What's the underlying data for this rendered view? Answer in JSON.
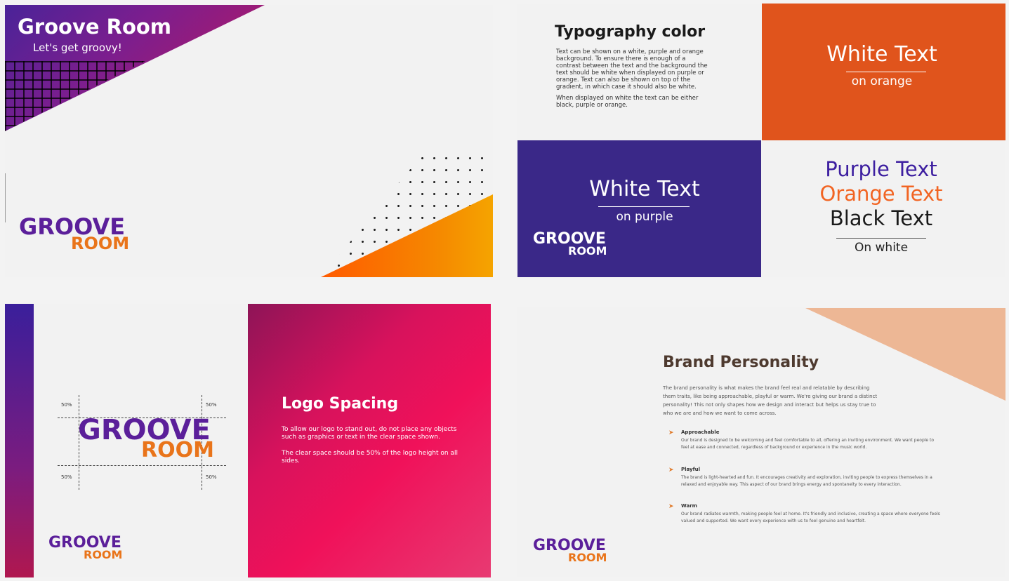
{
  "panel1": {
    "title": "Groove Room",
    "subtitle": "Let's get groovy!",
    "logo": {
      "line1": "GROOVE",
      "line2": "ROOM"
    }
  },
  "panel2": {
    "heading": "Typography color",
    "body": [
      "Text can be shown on a white, purple and orange background. To ensure there is enough of a contrast between the text and the background the text should be white when displayed on purple or orange. Text can also be shown on top of the gradient, in which case it should also be white.",
      "When displayed on white the text can be either black, purple or orange."
    ],
    "orange_card": {
      "main": "White Text",
      "sub": "on orange",
      "color": "#e0541c"
    },
    "purple_card": {
      "main": "White Text",
      "sub": "on purple",
      "color": "#3a2888"
    },
    "white_card": {
      "purple": "Purple Text",
      "orange": "Orange Text",
      "black": "Black Text",
      "sub": "On white"
    },
    "logo": {
      "line1": "GROOVE",
      "line2": "ROOM"
    },
    "colors": {
      "purple_text": "#3d1fa0",
      "orange_text": "#f26422",
      "black_text": "#1a1a1a"
    }
  },
  "panel3": {
    "heading": "Logo Spacing",
    "body": [
      "To allow our logo to stand out, do not place any objects such as graphics or text in the clear space shown.",
      "The clear space should be 50% of the logo height on all sides."
    ],
    "pct_labels": [
      "50%",
      "50%",
      "50%",
      "50%"
    ],
    "logo_big": {
      "line1": "GROOVE",
      "line2": "ROOM"
    },
    "logo_small": {
      "line1": "GROOVE",
      "line2": "ROOM"
    }
  },
  "panel4": {
    "heading": "Brand Personality",
    "intro": "The brand personality is what makes the brand feel real and relatable by describing them traits, like being approachable, playful or warm. We're giving our brand a distinct personality! This not only shapes how we design and interact but helps us stay true to who we are and how we want to come across.",
    "items": [
      {
        "title": "Approachable",
        "desc": "Our brand is designed to be welcoming and feel comfortable to all, offering an inviting environment. We want people to feel at ease and connected, regardless of background or experience in the music world."
      },
      {
        "title": "Playful",
        "desc": "The brand is light-hearted and fun. It encourages creativity and exploration, inviting people to express themselves in a relaxed and enjoyable way. This aspect of our brand brings energy and spontaneity to every interaction."
      },
      {
        "title": "Warm",
        "desc": "Our brand radiates warmth, making people feel at home. It's friendly and inclusive, creating a space where everyone feels valued and supported. We want every experience with us to feel genuine and heartfelt."
      }
    ],
    "logo": {
      "line1": "GROOVE",
      "line2": "ROOM"
    }
  }
}
